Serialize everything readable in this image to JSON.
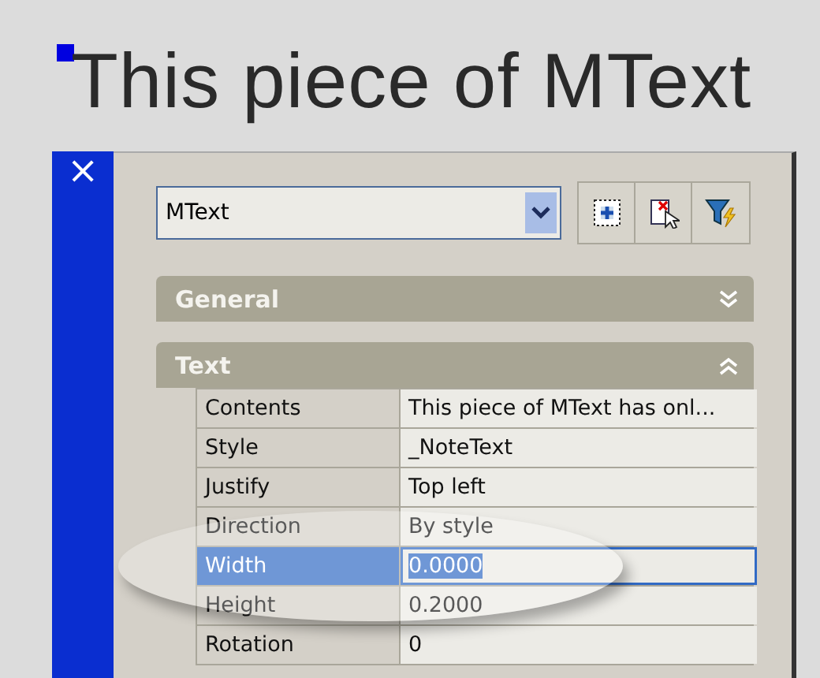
{
  "heading": {
    "text": "This piece of MText"
  },
  "palette": {
    "close": "×",
    "object_type": {
      "value": "MText"
    },
    "toolbar": [
      {
        "kind": "quickselect"
      },
      {
        "kind": "selectobjects"
      },
      {
        "kind": "filter"
      }
    ],
    "sections": [
      {
        "title": "General",
        "expanded": false
      },
      {
        "title": "Text",
        "expanded": true,
        "rows": [
          {
            "label": "Contents",
            "value": "This piece of MText has onl...",
            "selected": false
          },
          {
            "label": "Style",
            "value": "_NoteText",
            "selected": false
          },
          {
            "label": "Justify",
            "value": "Top left",
            "selected": false
          },
          {
            "label": "Direction",
            "value": "By style",
            "selected": false
          },
          {
            "label": "Width",
            "value": "0.0000",
            "selected": true
          },
          {
            "label": "Height",
            "value": "0.2000",
            "selected": false
          },
          {
            "label": "Rotation",
            "value": "0",
            "selected": false
          }
        ]
      }
    ]
  }
}
